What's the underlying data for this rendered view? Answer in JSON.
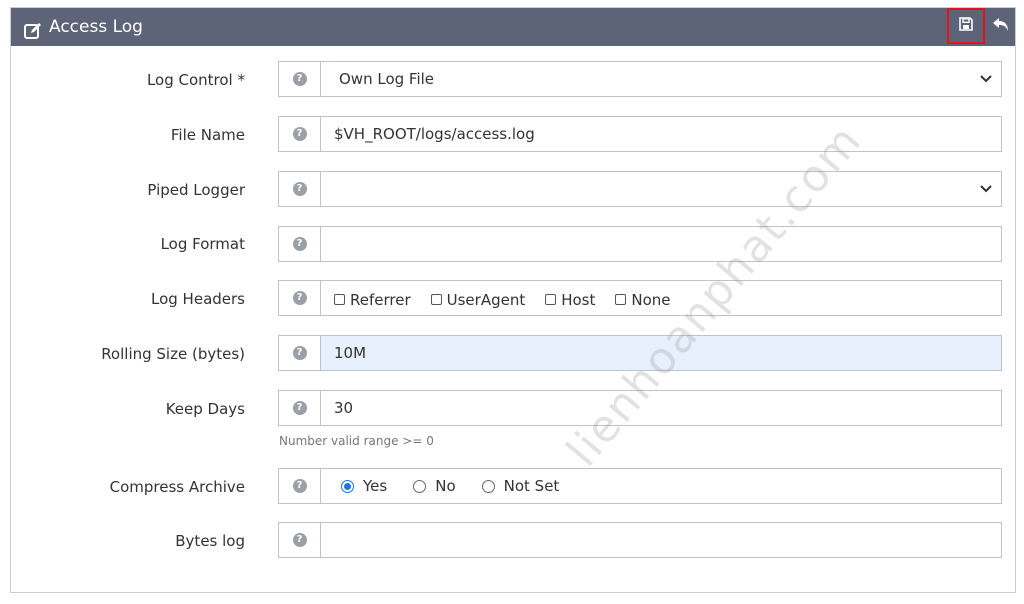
{
  "header": {
    "title": "Access Log",
    "title_icon": "edit-icon",
    "save_icon": "save-icon",
    "back_icon": "undo-arrow-icon"
  },
  "fields": {
    "log_control": {
      "label": "Log Control *",
      "value": "Own Log File"
    },
    "file_name": {
      "label": "File Name",
      "value": "$VH_ROOT/logs/access.log"
    },
    "piped_logger": {
      "label": "Piped Logger",
      "value": ""
    },
    "log_format": {
      "label": "Log Format",
      "value": ""
    },
    "log_headers": {
      "label": "Log Headers",
      "options": [
        "Referrer",
        "UserAgent",
        "Host",
        "None"
      ]
    },
    "rolling_size": {
      "label": "Rolling Size (bytes)",
      "value": "10M"
    },
    "keep_days": {
      "label": "Keep Days",
      "value": "30",
      "hint": "Number valid range >= 0"
    },
    "compress_archive": {
      "label": "Compress Archive",
      "options": [
        "Yes",
        "No",
        "Not Set"
      ],
      "selected": "Yes"
    },
    "bytes_log": {
      "label": "Bytes log",
      "value": ""
    }
  },
  "watermark": "lienhoanphat.com",
  "colors": {
    "header_bg": "#5d6478",
    "save_highlight": "#e3121b",
    "radio_accent": "#1a73e8",
    "autofill_bg": "#e8f0fe"
  }
}
